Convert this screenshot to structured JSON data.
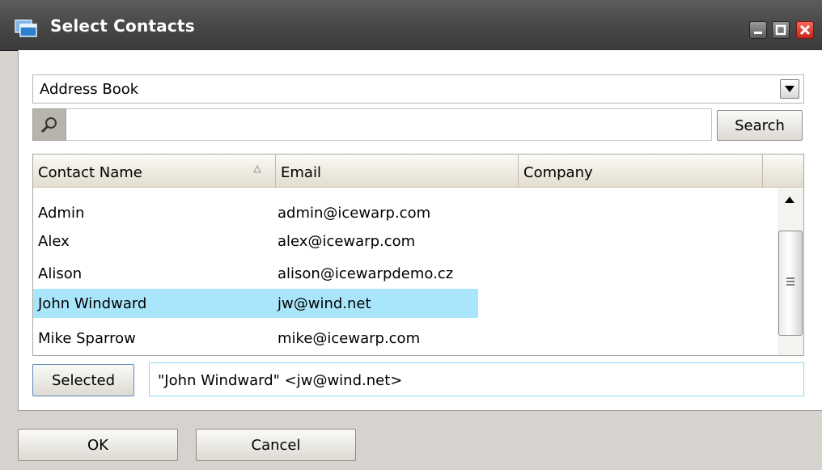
{
  "window": {
    "title": "Select Contacts",
    "icon": "window-stack-icon",
    "controls": [
      "minimize-icon",
      "maximize-icon",
      "close-icon"
    ]
  },
  "source_select": {
    "selected": "Address Book",
    "icon": "chevron-down-icon"
  },
  "search": {
    "icon": "magnifier-icon",
    "value": "",
    "button_label": "Search"
  },
  "table": {
    "columns": [
      "Contact Name",
      "Email",
      "Company"
    ],
    "sorted_column": "Contact Name",
    "rows": [
      {
        "name": "Admin",
        "email": "admin@icewarp.com",
        "company": ""
      },
      {
        "name": "Alex",
        "email": "alex@icewarp.com",
        "company": ""
      },
      {
        "name": "Alison",
        "email": "alison@icewarpdemo.cz",
        "company": ""
      },
      {
        "name": "John Windward",
        "email": "jw@wind.net",
        "company": "",
        "selected": true
      },
      {
        "name": "Mike Sparrow",
        "email": "mike@icewarp.com",
        "company": ""
      }
    ]
  },
  "selected_button_label": "Selected",
  "selected_value": "\"John Windward\" <jw@wind.net>",
  "footer": {
    "ok_label": "OK",
    "cancel_label": "Cancel"
  },
  "colors": {
    "titlebar": "#4a4a4a",
    "selection": "#a9e6fb",
    "dialog_bg": "#d6d3ce"
  }
}
